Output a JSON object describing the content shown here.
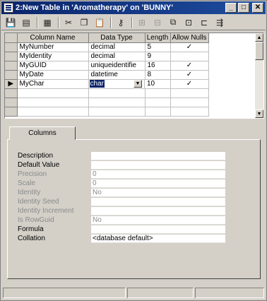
{
  "window": {
    "title": "2:New Table in 'Aromatherapy' on 'BUNNY'",
    "minimize_glyph": "_",
    "maximize_glyph": "□",
    "close_glyph": "✕"
  },
  "toolbar": {
    "buttons": [
      {
        "name": "save-icon",
        "glyph": "💾"
      },
      {
        "name": "properties-icon",
        "glyph": "▤"
      },
      {
        "name": "generate-script-icon",
        "glyph": "▦"
      },
      {
        "name": "cut-icon",
        "glyph": "✂"
      },
      {
        "name": "copy-icon",
        "glyph": "❐"
      },
      {
        "name": "paste-icon",
        "glyph": "📋"
      },
      {
        "name": "set-primary-key-icon",
        "glyph": "⚷"
      },
      {
        "name": "insert-column-icon",
        "glyph": "⊞"
      },
      {
        "name": "delete-column-icon",
        "glyph": "⊟"
      },
      {
        "name": "manage-relationships-icon",
        "glyph": "⧉"
      },
      {
        "name": "manage-indexes-icon",
        "glyph": "⊡"
      },
      {
        "name": "manage-constraints-icon",
        "glyph": "⊏"
      },
      {
        "name": "manage-triggers-icon",
        "glyph": "⇶"
      }
    ]
  },
  "grid": {
    "headers": [
      "Column Name",
      "Data Type",
      "Length",
      "Allow Nulls"
    ],
    "rows": [
      {
        "name": "MyNumber",
        "type": "decimal",
        "length": "5",
        "nulls": "✓"
      },
      {
        "name": "MyIdentity",
        "type": "decimal",
        "length": "9",
        "nulls": ""
      },
      {
        "name": "MyGUID",
        "type": "uniqueidentifie",
        "length": "16",
        "nulls": "✓"
      },
      {
        "name": "MyDate",
        "type": "datetime",
        "length": "8",
        "nulls": "✓"
      },
      {
        "name": "MyChar",
        "type": "char",
        "length": "10",
        "nulls": "✓"
      }
    ],
    "current_row_marker": "▶",
    "dropdown_arrow": "▼",
    "scroll_up": "▲",
    "scroll_down": "▼"
  },
  "properties": {
    "tab_label": "Columns",
    "rows": [
      {
        "label": "Description",
        "value": "",
        "enabled": true
      },
      {
        "label": "Default Value",
        "value": "",
        "enabled": true
      },
      {
        "label": "Precision",
        "value": "0",
        "enabled": false
      },
      {
        "label": "Scale",
        "value": "0",
        "enabled": false
      },
      {
        "label": "Identity",
        "value": "No",
        "enabled": false
      },
      {
        "label": "Identity Seed",
        "value": "",
        "enabled": false
      },
      {
        "label": "Identity Increment",
        "value": "",
        "enabled": false
      },
      {
        "label": "Is RowGuid",
        "value": "No",
        "enabled": false
      },
      {
        "label": "Formula",
        "value": "",
        "enabled": true
      },
      {
        "label": "Collation",
        "value": "<database default>",
        "enabled": true
      }
    ]
  }
}
